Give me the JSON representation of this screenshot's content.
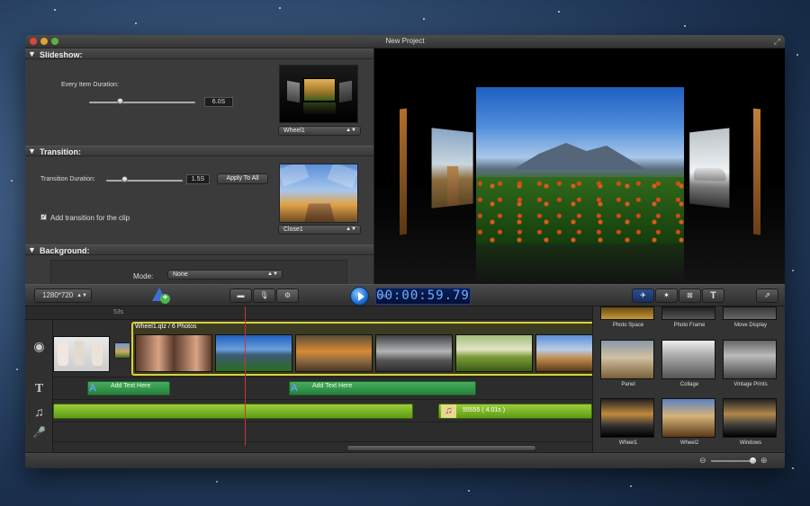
{
  "window": {
    "title": "New Project"
  },
  "slideshow": {
    "header": "Slideshow:",
    "duration_label": "Every Item Duration:",
    "duration_value": "6.0S",
    "style_selected": "Wheel1"
  },
  "transition": {
    "header": "Transition:",
    "duration_label": "Transition Duration:",
    "duration_value": "1.5S",
    "apply_all_label": "Apply To All",
    "add_clip_label": "Add transition for the clip",
    "add_clip_checked": true,
    "style_selected": "Close1"
  },
  "background": {
    "header": "Background:",
    "mode_label": "Mode:",
    "mode_value": "None"
  },
  "toolbar": {
    "resolution": "1280*720",
    "timecode": "00:00:59.79",
    "timecode_tag": "TIME"
  },
  "timeline": {
    "ruler_mark": "53s",
    "group_label": "Wheel1.qtz / 6 Photos",
    "title_clips": [
      {
        "label": "Add Text Here"
      },
      {
        "label": "Add Text Here"
      }
    ],
    "audio_label": "55555 ( 4.01s )"
  },
  "library": {
    "row1": [
      "Photo Space",
      "Photo Frame",
      "Move Display"
    ],
    "items": [
      "Panel",
      "Collage",
      "Vintage Prints",
      "Wheel1",
      "Wheel2",
      "Windows"
    ]
  },
  "colors": {
    "accent": "#1d6fd2",
    "timecode": "#6fb0ff",
    "playhead": "#cc3333",
    "audio": "#8cc43a",
    "title_clip": "#2f9a4a",
    "clip_border": "#d7d23a"
  },
  "icons": [
    "triangle-down-icon",
    "add-media-icon",
    "camera-icon",
    "microphone-icon",
    "gear-icon",
    "play-icon",
    "settings-wand-icon",
    "sparkle-icon",
    "transition-icon",
    "text-icon",
    "share-icon",
    "film-icon",
    "music-icon",
    "zoom-out-icon",
    "zoom-in-icon"
  ]
}
